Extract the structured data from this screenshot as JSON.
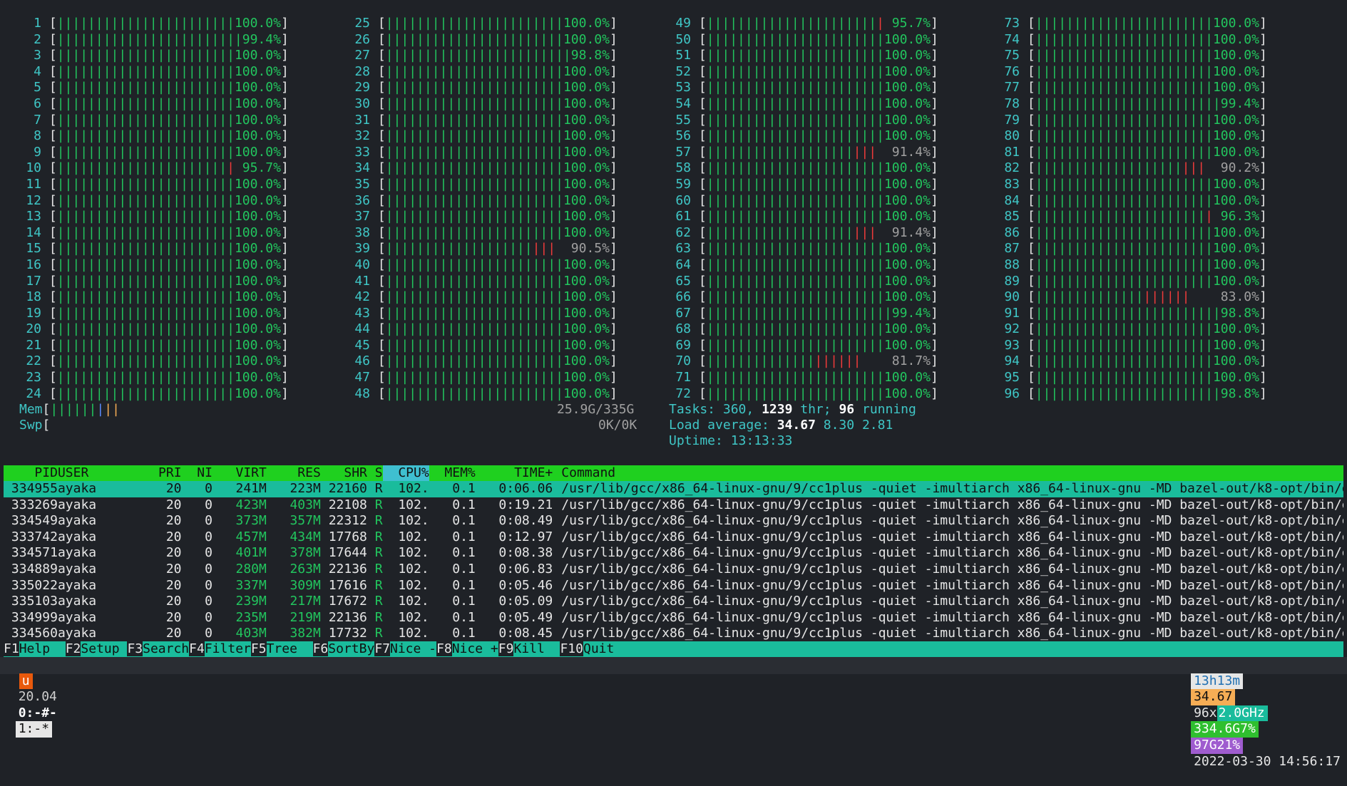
{
  "colors": {
    "bar": "#22c55e",
    "accent": "#3fc6c6",
    "red": "#ef3b3b",
    "header": "#1fd01f",
    "selected": "#1abc9c",
    "tmux_orange": "#e8590c",
    "tmux_yellow": "#f6ad55",
    "tmux_green": "#2fbf2f",
    "tmux_purple": "#9f5ccf",
    "tmux_blue": "#5bc0ff"
  },
  "cpus": [
    {
      "n": "1",
      "pct": "100.0%"
    },
    {
      "n": "2",
      "pct": "99.4%"
    },
    {
      "n": "3",
      "pct": "100.0%"
    },
    {
      "n": "4",
      "pct": "100.0%"
    },
    {
      "n": "5",
      "pct": "100.0%"
    },
    {
      "n": "6",
      "pct": "100.0%"
    },
    {
      "n": "7",
      "pct": "100.0%"
    },
    {
      "n": "8",
      "pct": "100.0%"
    },
    {
      "n": "9",
      "pct": "100.0%"
    },
    {
      "n": "10",
      "pct": "95.7%"
    },
    {
      "n": "11",
      "pct": "100.0%"
    },
    {
      "n": "12",
      "pct": "100.0%"
    },
    {
      "n": "13",
      "pct": "100.0%"
    },
    {
      "n": "14",
      "pct": "100.0%"
    },
    {
      "n": "15",
      "pct": "100.0%"
    },
    {
      "n": "16",
      "pct": "100.0%"
    },
    {
      "n": "17",
      "pct": "100.0%"
    },
    {
      "n": "18",
      "pct": "100.0%"
    },
    {
      "n": "19",
      "pct": "100.0%"
    },
    {
      "n": "20",
      "pct": "100.0%"
    },
    {
      "n": "21",
      "pct": "100.0%"
    },
    {
      "n": "22",
      "pct": "100.0%"
    },
    {
      "n": "23",
      "pct": "100.0%"
    },
    {
      "n": "24",
      "pct": "100.0%"
    },
    {
      "n": "25",
      "pct": "100.0%"
    },
    {
      "n": "26",
      "pct": "100.0%"
    },
    {
      "n": "27",
      "pct": "98.8%"
    },
    {
      "n": "28",
      "pct": "100.0%"
    },
    {
      "n": "29",
      "pct": "100.0%"
    },
    {
      "n": "30",
      "pct": "100.0%"
    },
    {
      "n": "31",
      "pct": "100.0%"
    },
    {
      "n": "32",
      "pct": "100.0%"
    },
    {
      "n": "33",
      "pct": "100.0%"
    },
    {
      "n": "34",
      "pct": "100.0%"
    },
    {
      "n": "35",
      "pct": "100.0%"
    },
    {
      "n": "36",
      "pct": "100.0%"
    },
    {
      "n": "37",
      "pct": "100.0%"
    },
    {
      "n": "38",
      "pct": "100.0%"
    },
    {
      "n": "39",
      "pct": "90.5%"
    },
    {
      "n": "40",
      "pct": "100.0%"
    },
    {
      "n": "41",
      "pct": "100.0%"
    },
    {
      "n": "42",
      "pct": "100.0%"
    },
    {
      "n": "43",
      "pct": "100.0%"
    },
    {
      "n": "44",
      "pct": "100.0%"
    },
    {
      "n": "45",
      "pct": "100.0%"
    },
    {
      "n": "46",
      "pct": "100.0%"
    },
    {
      "n": "47",
      "pct": "100.0%"
    },
    {
      "n": "48",
      "pct": "100.0%"
    },
    {
      "n": "49",
      "pct": "95.7%"
    },
    {
      "n": "50",
      "pct": "100.0%"
    },
    {
      "n": "51",
      "pct": "100.0%"
    },
    {
      "n": "52",
      "pct": "100.0%"
    },
    {
      "n": "53",
      "pct": "100.0%"
    },
    {
      "n": "54",
      "pct": "100.0%"
    },
    {
      "n": "55",
      "pct": "100.0%"
    },
    {
      "n": "56",
      "pct": "100.0%"
    },
    {
      "n": "57",
      "pct": "91.4%"
    },
    {
      "n": "58",
      "pct": "100.0%"
    },
    {
      "n": "59",
      "pct": "100.0%"
    },
    {
      "n": "60",
      "pct": "100.0%"
    },
    {
      "n": "61",
      "pct": "100.0%"
    },
    {
      "n": "62",
      "pct": "91.4%"
    },
    {
      "n": "63",
      "pct": "100.0%"
    },
    {
      "n": "64",
      "pct": "100.0%"
    },
    {
      "n": "65",
      "pct": "100.0%"
    },
    {
      "n": "66",
      "pct": "100.0%"
    },
    {
      "n": "67",
      "pct": "99.4%"
    },
    {
      "n": "68",
      "pct": "100.0%"
    },
    {
      "n": "69",
      "pct": "100.0%"
    },
    {
      "n": "70",
      "pct": "81.7%"
    },
    {
      "n": "71",
      "pct": "100.0%"
    },
    {
      "n": "72",
      "pct": "100.0%"
    },
    {
      "n": "73",
      "pct": "100.0%"
    },
    {
      "n": "74",
      "pct": "100.0%"
    },
    {
      "n": "75",
      "pct": "100.0%"
    },
    {
      "n": "76",
      "pct": "100.0%"
    },
    {
      "n": "77",
      "pct": "100.0%"
    },
    {
      "n": "78",
      "pct": "99.4%"
    },
    {
      "n": "79",
      "pct": "100.0%"
    },
    {
      "n": "80",
      "pct": "100.0%"
    },
    {
      "n": "81",
      "pct": "100.0%"
    },
    {
      "n": "82",
      "pct": "90.2%"
    },
    {
      "n": "83",
      "pct": "100.0%"
    },
    {
      "n": "84",
      "pct": "100.0%"
    },
    {
      "n": "85",
      "pct": "96.3%"
    },
    {
      "n": "86",
      "pct": "100.0%"
    },
    {
      "n": "87",
      "pct": "100.0%"
    },
    {
      "n": "88",
      "pct": "100.0%"
    },
    {
      "n": "89",
      "pct": "100.0%"
    },
    {
      "n": "90",
      "pct": "83.0%"
    },
    {
      "n": "91",
      "pct": "98.8%"
    },
    {
      "n": "92",
      "pct": "100.0%"
    },
    {
      "n": "93",
      "pct": "100.0%"
    },
    {
      "n": "94",
      "pct": "100.0%"
    },
    {
      "n": "95",
      "pct": "100.0%"
    },
    {
      "n": "96",
      "pct": "98.8%"
    }
  ],
  "mem": {
    "label": "Mem",
    "value": "25.9G/335G"
  },
  "swp": {
    "label": "Swp",
    "value": "0K/0K"
  },
  "tasks": {
    "label": "Tasks: ",
    "count": "360",
    "thr": "1239",
    "thr_label": " thr; ",
    "running": "96",
    "running_label": " running"
  },
  "load": {
    "label": "Load average: ",
    "l1": "34.67",
    "l5": "8.30",
    "l15": "2.81"
  },
  "uptime": {
    "label": "Uptime: ",
    "value": "13:13:33"
  },
  "columns": [
    "PID",
    "USER",
    "PRI",
    "NI",
    "VIRT",
    "RES",
    "SHR",
    "S",
    "CPU%",
    "MEM%",
    "TIME+",
    "Command"
  ],
  "processes": [
    {
      "pid": "334955",
      "user": "ayaka",
      "pri": "20",
      "ni": "0",
      "virt": "241M",
      "res": "223M",
      "shr": "22160",
      "s": "R",
      "cpu": "102.",
      "mem": "0.1",
      "time": "0:06.06",
      "cmd": "/usr/lib/gcc/x86_64-linux-gnu/9/cc1plus -quiet -imultiarch x86_64-linux-gnu -MD bazel-out/k8-opt/bin/e"
    },
    {
      "pid": "333269",
      "user": "ayaka",
      "pri": "20",
      "ni": "0",
      "virt": "423M",
      "res": "403M",
      "shr": "22108",
      "s": "R",
      "cpu": "102.",
      "mem": "0.1",
      "time": "0:19.21",
      "cmd": "/usr/lib/gcc/x86_64-linux-gnu/9/cc1plus -quiet -imultiarch x86_64-linux-gnu -MD bazel-out/k8-opt/bin/e"
    },
    {
      "pid": "334549",
      "user": "ayaka",
      "pri": "20",
      "ni": "0",
      "virt": "373M",
      "res": "357M",
      "shr": "22312",
      "s": "R",
      "cpu": "102.",
      "mem": "0.1",
      "time": "0:08.49",
      "cmd": "/usr/lib/gcc/x86_64-linux-gnu/9/cc1plus -quiet -imultiarch x86_64-linux-gnu -MD bazel-out/k8-opt/bin/e"
    },
    {
      "pid": "333742",
      "user": "ayaka",
      "pri": "20",
      "ni": "0",
      "virt": "457M",
      "res": "434M",
      "shr": "17768",
      "s": "R",
      "cpu": "102.",
      "mem": "0.1",
      "time": "0:12.97",
      "cmd": "/usr/lib/gcc/x86_64-linux-gnu/9/cc1plus -quiet -imultiarch x86_64-linux-gnu -MD bazel-out/k8-opt/bin/e"
    },
    {
      "pid": "334571",
      "user": "ayaka",
      "pri": "20",
      "ni": "0",
      "virt": "401M",
      "res": "378M",
      "shr": "17644",
      "s": "R",
      "cpu": "102.",
      "mem": "0.1",
      "time": "0:08.38",
      "cmd": "/usr/lib/gcc/x86_64-linux-gnu/9/cc1plus -quiet -imultiarch x86_64-linux-gnu -MD bazel-out/k8-opt/bin/e"
    },
    {
      "pid": "334889",
      "user": "ayaka",
      "pri": "20",
      "ni": "0",
      "virt": "280M",
      "res": "263M",
      "shr": "22136",
      "s": "R",
      "cpu": "102.",
      "mem": "0.1",
      "time": "0:06.83",
      "cmd": "/usr/lib/gcc/x86_64-linux-gnu/9/cc1plus -quiet -imultiarch x86_64-linux-gnu -MD bazel-out/k8-opt/bin/e"
    },
    {
      "pid": "335022",
      "user": "ayaka",
      "pri": "20",
      "ni": "0",
      "virt": "337M",
      "res": "309M",
      "shr": "17616",
      "s": "R",
      "cpu": "102.",
      "mem": "0.1",
      "time": "0:05.46",
      "cmd": "/usr/lib/gcc/x86_64-linux-gnu/9/cc1plus -quiet -imultiarch x86_64-linux-gnu -MD bazel-out/k8-opt/bin/e"
    },
    {
      "pid": "335103",
      "user": "ayaka",
      "pri": "20",
      "ni": "0",
      "virt": "239M",
      "res": "217M",
      "shr": "17672",
      "s": "R",
      "cpu": "102.",
      "mem": "0.1",
      "time": "0:05.09",
      "cmd": "/usr/lib/gcc/x86_64-linux-gnu/9/cc1plus -quiet -imultiarch x86_64-linux-gnu -MD bazel-out/k8-opt/bin/e"
    },
    {
      "pid": "334999",
      "user": "ayaka",
      "pri": "20",
      "ni": "0",
      "virt": "235M",
      "res": "219M",
      "shr": "22136",
      "s": "R",
      "cpu": "102.",
      "mem": "0.1",
      "time": "0:05.49",
      "cmd": "/usr/lib/gcc/x86_64-linux-gnu/9/cc1plus -quiet -imultiarch x86_64-linux-gnu -MD bazel-out/k8-opt/bin/e"
    },
    {
      "pid": "334560",
      "user": "ayaka",
      "pri": "20",
      "ni": "0",
      "virt": "403M",
      "res": "382M",
      "shr": "17732",
      "s": "R",
      "cpu": "102.",
      "mem": "0.1",
      "time": "0:08.45",
      "cmd": "/usr/lib/gcc/x86_64-linux-gnu/9/cc1plus -quiet -imultiarch x86_64-linux-gnu -MD bazel-out/k8-opt/bin/e"
    }
  ],
  "fkeys": [
    {
      "key": "F1",
      "label": "Help  "
    },
    {
      "key": "F2",
      "label": "Setup "
    },
    {
      "key": "F3",
      "label": "Search"
    },
    {
      "key": "F4",
      "label": "Filter"
    },
    {
      "key": "F5",
      "label": "Tree  "
    },
    {
      "key": "F6",
      "label": "SortBy"
    },
    {
      "key": "F7",
      "label": "Nice -"
    },
    {
      "key": "F8",
      "label": "Nice +"
    },
    {
      "key": "F9",
      "label": "Kill  "
    },
    {
      "key": "F10",
      "label": "Quit"
    }
  ],
  "tmux": {
    "session": "u",
    "os": "20.04",
    "win0": "0:-#-",
    "win1": "1:-*",
    "uptime": "13h13m",
    "load": "34.67",
    "cpu_freq_prefix": "96x",
    "cpu_freq": "2.0GHz",
    "mem": "334.6G7%",
    "mem2": "97G21%",
    "datetime": "2022-03-30 14:56:17"
  }
}
